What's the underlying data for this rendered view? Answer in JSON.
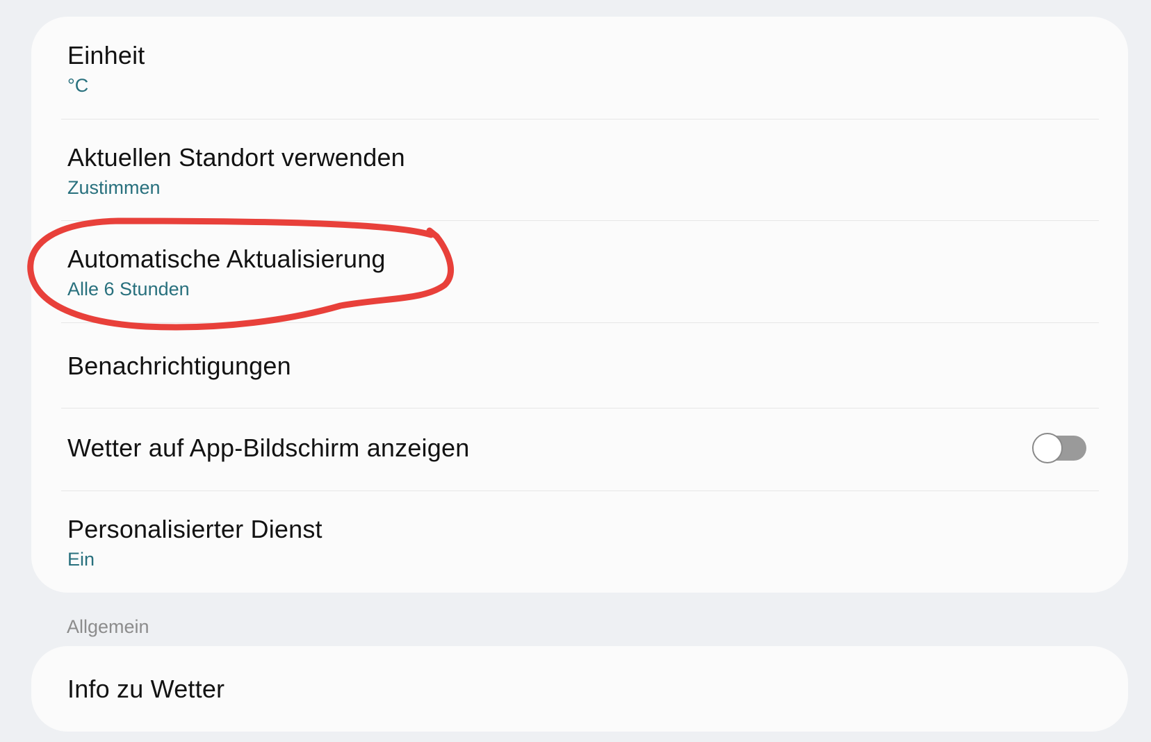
{
  "settings": {
    "items": [
      {
        "title": "Einheit",
        "value": "°C"
      },
      {
        "title": "Aktuellen Standort verwenden",
        "value": "Zustimmen"
      },
      {
        "title": "Automatische Aktualisierung",
        "value": "Alle 6 Stunden"
      },
      {
        "title": "Benachrichtigungen"
      },
      {
        "title": "Wetter auf App-Bildschirm anzeigen",
        "toggle_on": false
      },
      {
        "title": "Personalisierter Dienst",
        "value": "Ein"
      }
    ]
  },
  "general": {
    "header": "Allgemein",
    "items": [
      {
        "title": "Info zu Wetter"
      }
    ]
  },
  "colors": {
    "background": "#eef0f3",
    "card": "#fbfbfb",
    "title_text": "#121212",
    "value_text": "#28707d",
    "section_header_text": "#8c8c8c",
    "toggle_off_track": "#9a9a9a",
    "annotation_stroke": "#e8403a"
  },
  "annotation": {
    "shape": "hand-drawn-ellipse",
    "target": "Automatische Aktualisierung"
  }
}
